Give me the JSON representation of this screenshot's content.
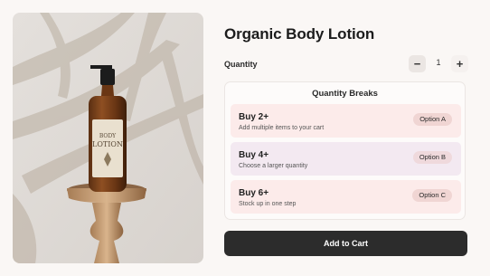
{
  "product": {
    "title": "Organic Body Lotion",
    "image_label_line1": "BODY",
    "image_label_line2": "LOTION"
  },
  "quantity": {
    "label": "Quantity",
    "value": "1",
    "minus_symbol": "−",
    "plus_symbol": "+"
  },
  "quantity_breaks": {
    "title": "Quantity Breaks",
    "items": [
      {
        "name": "Buy 2+",
        "description": "Add multiple items to your cart",
        "option": "Option A",
        "bg": "#fcebea",
        "option_bg": "#f0d5d3"
      },
      {
        "name": "Buy 4+",
        "description": "Choose a larger quantity",
        "option": "Option B",
        "bg": "#f3e9f1",
        "option_bg": "#efd9dc"
      },
      {
        "name": "Buy 6+",
        "description": "Stock up in one step",
        "option": "Option C",
        "bg": "#fcebea",
        "option_bg": "#f0d5d3"
      }
    ]
  },
  "cart": {
    "add_label": "Add to Cart"
  },
  "colors": {
    "accent_dark": "#2c2c2c",
    "page_bg": "#faf7f5"
  }
}
